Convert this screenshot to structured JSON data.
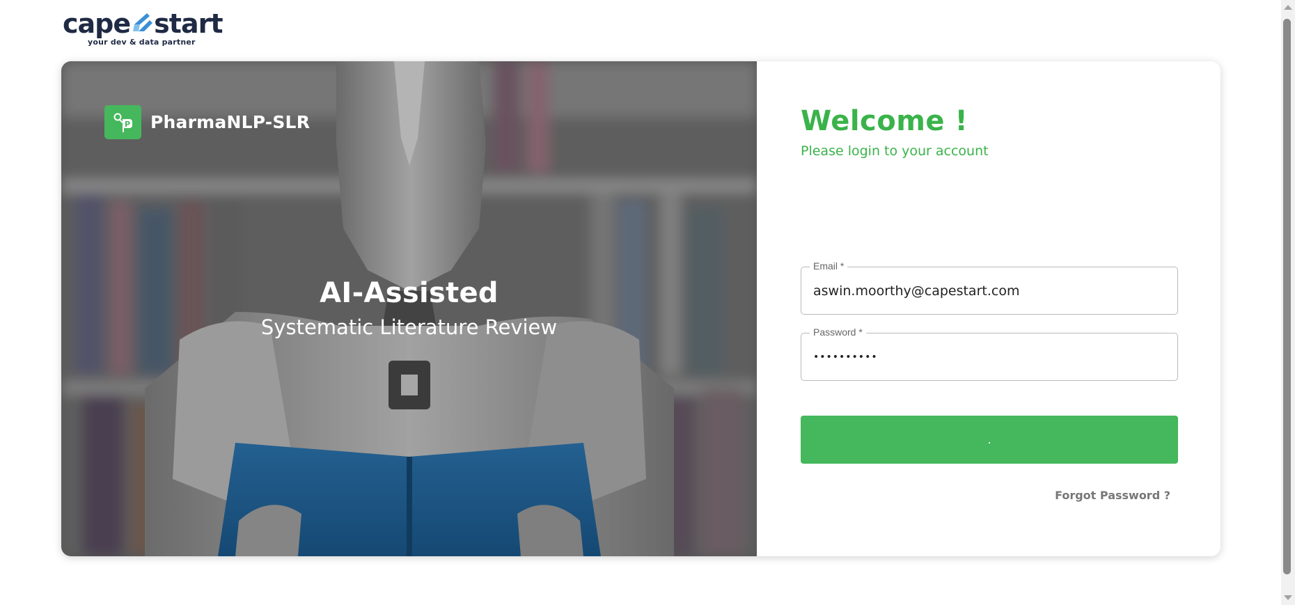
{
  "brand": {
    "word_left": "cape",
    "word_right": "start",
    "tagline": "your dev & data partner",
    "color": "#1f2a44",
    "accent": "#3a8fd6"
  },
  "hero": {
    "app_name": "PharmaNLP-SLR",
    "app_icon": "pin-flag-icon",
    "title": "AI-Assisted",
    "subtitle": "Systematic Literature Review"
  },
  "login": {
    "welcome": "Welcome !",
    "subtitle": "Please login to your account",
    "email_label": "Email *",
    "email_value": "aswin.moorthy@capestart.com",
    "password_label": "Password *",
    "password_value": "••••••••••",
    "button_label": ".",
    "forgot_label": "Forgot Password ?",
    "accent_color": "#45b75c"
  }
}
